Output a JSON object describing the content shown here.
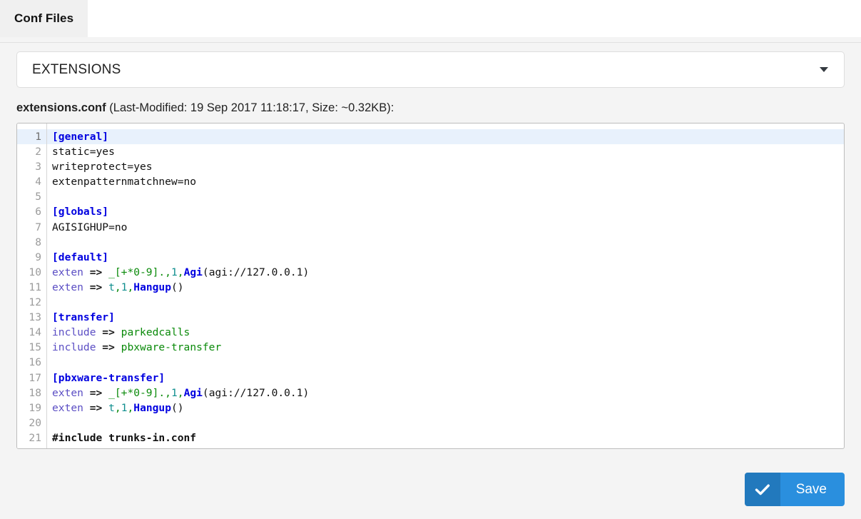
{
  "tabs": [
    {
      "label": "Conf Files",
      "active": true
    }
  ],
  "file_selector": {
    "selected": "EXTENSIONS",
    "icon": "chevron-down-icon",
    "options": [
      "EXTENSIONS"
    ]
  },
  "file_info": {
    "filename": "extensions.conf",
    "meta": " (Last-Modified: 19 Sep 2017 11:18:17, Size: ~0.32KB):",
    "last_modified": "19 Sep 2017 11:18:17",
    "size": "~0.32KB"
  },
  "editor": {
    "active_line": 1,
    "line_count": 21,
    "lines": [
      {
        "n": 1,
        "tokens": [
          {
            "t": "[general]",
            "c": "tok-section"
          }
        ]
      },
      {
        "n": 2,
        "tokens": [
          {
            "t": "static=yes",
            "c": "tok-plain"
          }
        ]
      },
      {
        "n": 3,
        "tokens": [
          {
            "t": "writeprotect=yes",
            "c": "tok-plain"
          }
        ]
      },
      {
        "n": 4,
        "tokens": [
          {
            "t": "extenpatternmatchnew=no",
            "c": "tok-plain"
          }
        ]
      },
      {
        "n": 5,
        "tokens": []
      },
      {
        "n": 6,
        "tokens": [
          {
            "t": "[globals]",
            "c": "tok-section"
          }
        ]
      },
      {
        "n": 7,
        "tokens": [
          {
            "t": "AGISIGHUP=no",
            "c": "tok-plain"
          }
        ]
      },
      {
        "n": 8,
        "tokens": []
      },
      {
        "n": 9,
        "tokens": [
          {
            "t": "[default]",
            "c": "tok-section"
          }
        ]
      },
      {
        "n": 10,
        "tokens": [
          {
            "t": "exten ",
            "c": "tok-kw"
          },
          {
            "t": "=>",
            "c": "tok-op"
          },
          {
            "t": " ",
            "c": "tok-plain"
          },
          {
            "t": "_[+*0-9].,",
            "c": "tok-str"
          },
          {
            "t": "1",
            "c": "tok-num"
          },
          {
            "t": ",",
            "c": "tok-str"
          },
          {
            "t": "Agi",
            "c": "tok-fn"
          },
          {
            "t": "(agi://127.0.0.1)",
            "c": "tok-plain"
          }
        ]
      },
      {
        "n": 11,
        "tokens": [
          {
            "t": "exten ",
            "c": "tok-kw"
          },
          {
            "t": "=>",
            "c": "tok-op"
          },
          {
            "t": " ",
            "c": "tok-plain"
          },
          {
            "t": "t",
            "c": "tok-num"
          },
          {
            "t": ",",
            "c": "tok-str"
          },
          {
            "t": "1",
            "c": "tok-num"
          },
          {
            "t": ",",
            "c": "tok-str"
          },
          {
            "t": "Hangup",
            "c": "tok-fn"
          },
          {
            "t": "()",
            "c": "tok-plain"
          }
        ]
      },
      {
        "n": 12,
        "tokens": []
      },
      {
        "n": 13,
        "tokens": [
          {
            "t": "[transfer]",
            "c": "tok-section"
          }
        ]
      },
      {
        "n": 14,
        "tokens": [
          {
            "t": "include ",
            "c": "tok-kw"
          },
          {
            "t": "=>",
            "c": "tok-op"
          },
          {
            "t": " ",
            "c": "tok-plain"
          },
          {
            "t": "parkedcalls",
            "c": "tok-str"
          }
        ]
      },
      {
        "n": 15,
        "tokens": [
          {
            "t": "include ",
            "c": "tok-kw"
          },
          {
            "t": "=>",
            "c": "tok-op"
          },
          {
            "t": " ",
            "c": "tok-plain"
          },
          {
            "t": "pbxware-transfer",
            "c": "tok-str"
          }
        ]
      },
      {
        "n": 16,
        "tokens": []
      },
      {
        "n": 17,
        "tokens": [
          {
            "t": "[pbxware-transfer]",
            "c": "tok-section"
          }
        ]
      },
      {
        "n": 18,
        "tokens": [
          {
            "t": "exten ",
            "c": "tok-kw"
          },
          {
            "t": "=>",
            "c": "tok-op"
          },
          {
            "t": " ",
            "c": "tok-plain"
          },
          {
            "t": "_[+*0-9].,",
            "c": "tok-str"
          },
          {
            "t": "1",
            "c": "tok-num"
          },
          {
            "t": ",",
            "c": "tok-str"
          },
          {
            "t": "Agi",
            "c": "tok-fn"
          },
          {
            "t": "(agi://127.0.0.1)",
            "c": "tok-plain"
          }
        ]
      },
      {
        "n": 19,
        "tokens": [
          {
            "t": "exten ",
            "c": "tok-kw"
          },
          {
            "t": "=>",
            "c": "tok-op"
          },
          {
            "t": " ",
            "c": "tok-plain"
          },
          {
            "t": "t",
            "c": "tok-num"
          },
          {
            "t": ",",
            "c": "tok-str"
          },
          {
            "t": "1",
            "c": "tok-num"
          },
          {
            "t": ",",
            "c": "tok-str"
          },
          {
            "t": "Hangup",
            "c": "tok-fn"
          },
          {
            "t": "()",
            "c": "tok-plain"
          }
        ]
      },
      {
        "n": 20,
        "tokens": []
      },
      {
        "n": 21,
        "tokens": [
          {
            "t": "#include trunks-in.conf",
            "c": "tok-pre"
          }
        ]
      }
    ],
    "plain_text": "[general]\nstatic=yes\nwriteprotect=yes\nextenpatternmatchnew=no\n\n[globals]\nAGISIGHUP=no\n\n[default]\nexten => _[+*0-9].,1,Agi(agi://127.0.0.1)\nexten => t,1,Hangup()\n\n[transfer]\ninclude => parkedcalls\ninclude => pbxware-transfer\n\n[pbxware-transfer]\nexten => _[+*0-9].,1,Agi(agi://127.0.0.1)\nexten => t,1,Hangup()\n\n#include trunks-in.conf"
  },
  "footer": {
    "save_label": "Save",
    "save_icon": "check-icon"
  },
  "colors": {
    "page_bg": "#f4f4f4",
    "tab_bg": "#f0f0f0",
    "save_icon_bg": "#2279bd",
    "save_label_bg": "#2a8fde",
    "active_line_bg": "#e8f1fc",
    "section_token": "#0000e0",
    "string_token": "#0a8a0a",
    "number_token": "#0f8e8e",
    "keyword_token": "#5b4ec4"
  }
}
